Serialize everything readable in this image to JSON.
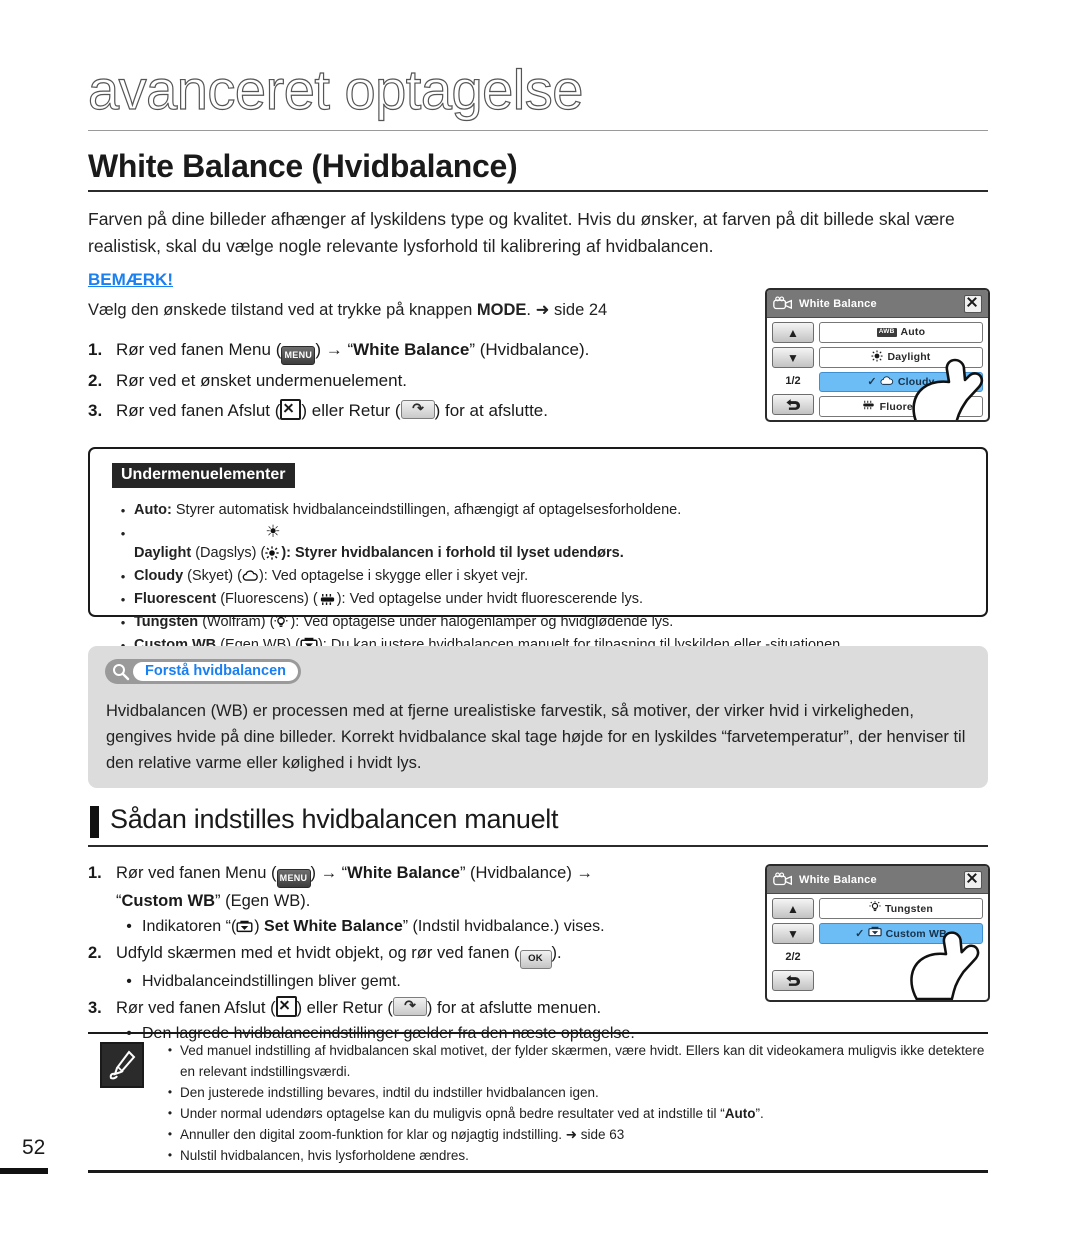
{
  "chapter": {
    "title": "avanceret optagelse"
  },
  "section": {
    "heading": "White Balance (Hvidbalance)"
  },
  "intro": {
    "text": "Farven på dine billeder afhænger af lyskildens type og kvalitet. Hvis du ønsker, at farven på dit billede skal være realistisk, skal du vælge nogle relevante lysforhold til kalibrering af hvidbalancen."
  },
  "note_link": {
    "label": "BEMÆRK!",
    "color": "#1a7ff0",
    "text_before": "Vælg den ønskede tilstand ved at trykke på knappen ",
    "mode_label": "MODE",
    "text_after": ". ➜ side 24"
  },
  "steps": {
    "items": [
      {
        "num": "1.",
        "pre": "Rør ved fanen Menu (",
        "icon": "menu-icon",
        "mid": ") → “",
        "bold": "White Balance",
        "post": "” (Hvidbalance)."
      },
      {
        "num": "2.",
        "pre": "Rør ved et ønsket undermenuelement.",
        "icon": "",
        "mid": "",
        "bold": "",
        "post": ""
      },
      {
        "num": "3.",
        "pre": "Rør ved fanen Afslut (",
        "icon": "close-icon",
        "mid": ") eller Retur (",
        "icon2": "return-icon",
        "post": ") for at afslutte."
      }
    ]
  },
  "submenu_box": {
    "banner": "Undermenuelementer",
    "items": [
      {
        "bullet": "•",
        "bold": "Auto:",
        "paren": "",
        "icon": "",
        "desc": " Styrer automatisk hvidbalanceindstillingen, afhængigt af optagelsesforholdene."
      },
      {
        "bullet": "•",
        "bold": "Daylight",
        "paren": " (Dagslys) (",
        "icon": "sun-icon",
        "desc": "): Styrer hvidbalancen i forhold til lyset udendørs."
      },
      {
        "bullet": "•",
        "bold": "Cloudy",
        "paren": " (Skyet) (",
        "icon": "cloud-icon",
        "desc": "): Ved optagelse i skygge eller i skyet vejr."
      },
      {
        "bullet": "•",
        "bold": "Fluorescent",
        "paren": " (Fluorescens) (",
        "icon": "fluorescent-icon",
        "desc": "): Ved optagelse under hvidt fluorescerende lys."
      },
      {
        "bullet": "•",
        "bold": "Tungsten",
        "paren": " (Wolfram) (",
        "icon": "tungsten-icon",
        "desc": "): Ved optagelse under halogenlamper og hvidglødende lys."
      },
      {
        "bullet": "•",
        "bold": "Custom WB",
        "paren": " (Egen WB) (",
        "icon": "custom-wb-icon",
        "desc": "): Du kan justere hvidbalancen manuelt for tilpasning til lyskilden eller -situationen."
      }
    ]
  },
  "info_box": {
    "badge_label": "Forstå hvidbalancen",
    "badge_text_color": "#1a7ff0",
    "badge_bg": "#9a9a9a",
    "box_bg": "#dcdcdc",
    "text": "Hvidbalancen (WB) er processen med at fjerne urealistiske farvestik, så motiver, der virker hvid i virkeligheden, gengives hvide på dine billeder. Korrekt hvidbalance skal tage højde for en lyskildes “farvetemperatur”, der henviser til den relative varme eller kølighed i hvidt lys."
  },
  "subsection": {
    "heading": "Sådan indstilles hvidbalancen manuelt"
  },
  "steps2": {
    "items": [
      {
        "num": "1.",
        "pre": "Rør ved fanen Menu (",
        "icon": "menu-icon",
        "mid": ") → “",
        "bold": "White Balance",
        "post": "” (Hvidbalance) →",
        "line2_q1": "“",
        "line2_bold": "Custom WB",
        "line2_post": "” (Egen WB).",
        "sub": {
          "pre": "Indikatoren “(",
          "icon": "custom-wb-icon",
          "mid": ") ",
          "bold": "Set White Balance",
          "post": "” (Indstil hvidbalance.) vises."
        }
      },
      {
        "num": "2.",
        "pre": "Udfyld skærmen med et hvidt objekt, og rør ved fanen (",
        "icon": "ok-icon",
        "post": ").",
        "sub": {
          "pre": "Hvidbalanceindstillingen bliver gemt.",
          "icon": "",
          "mid": "",
          "bold": "",
          "post": ""
        }
      },
      {
        "num": "3.",
        "pre": "Rør ved fanen Afslut (",
        "icon": "close-icon",
        "mid": ") eller Retur (",
        "icon2": "return-icon",
        "post": ") for at afslutte menuen.",
        "sub": {
          "pre": "Den lagrede hvidbalanceindstillinger gælder fra den næste optagelse.",
          "icon": "",
          "mid": "",
          "bold": "",
          "post": ""
        }
      }
    ]
  },
  "lcd1": {
    "title": "White Balance",
    "close_icon": "close-icon",
    "camera_icon": "camcorder-icon",
    "up_icon": "▲",
    "down_icon": "▼",
    "page_indicator": "1/2",
    "return_icon": "↶",
    "highlight_color": "#6cbcf5",
    "header_color": "#787878",
    "items": [
      {
        "label": "Auto",
        "icon": "awb-icon",
        "selected": false,
        "check": ""
      },
      {
        "label": "Daylight",
        "icon": "sun-icon",
        "selected": false,
        "check": ""
      },
      {
        "label": "Cloudy",
        "icon": "cloud-icon",
        "selected": true,
        "check": "✓"
      },
      {
        "label": "Fluorescent",
        "icon": "fluorescent-icon",
        "selected": false,
        "check": ""
      }
    ]
  },
  "lcd2": {
    "title": "White Balance",
    "close_icon": "close-icon",
    "camera_icon": "camcorder-icon",
    "up_icon": "▲",
    "down_icon": "▼",
    "page_indicator": "2/2",
    "return_icon": "↶",
    "highlight_color": "#6cbcf5",
    "items": [
      {
        "label": "Tungsten",
        "icon": "tungsten-icon",
        "selected": false,
        "check": ""
      },
      {
        "label": "Custom WB",
        "icon": "custom-wb-icon",
        "selected": true,
        "check": "✓"
      }
    ]
  },
  "bottom_notes": {
    "icon": "note-pen-icon",
    "items": [
      {
        "bullet": "•",
        "pre": "Ved manuel indstilling af hvidbalancen skal motivet, der fylder skærmen, være hvidt. Ellers kan dit videokamera muligvis ikke detektere en relevant indstillingsværdi.",
        "bold": "",
        "post": ""
      },
      {
        "bullet": "•",
        "pre": "Den justerede indstilling bevares, indtil du indstiller hvidbalancen igen.",
        "bold": "",
        "post": ""
      },
      {
        "bullet": "•",
        "pre": "Under normal udendørs optagelse kan du muligvis opnå bedre resultater ved at indstille til “",
        "bold": "Auto",
        "post": "”."
      },
      {
        "bullet": "•",
        "pre": "Annuller den digital zoom-funktion for klar og nøjagtig indstilling. ➜ side 63",
        "bold": "",
        "post": ""
      },
      {
        "bullet": "•",
        "pre": "Nulstil hvidbalancen, hvis lysforholdene ændres.",
        "bold": "",
        "post": ""
      }
    ]
  },
  "footer": {
    "page_number": "52"
  }
}
